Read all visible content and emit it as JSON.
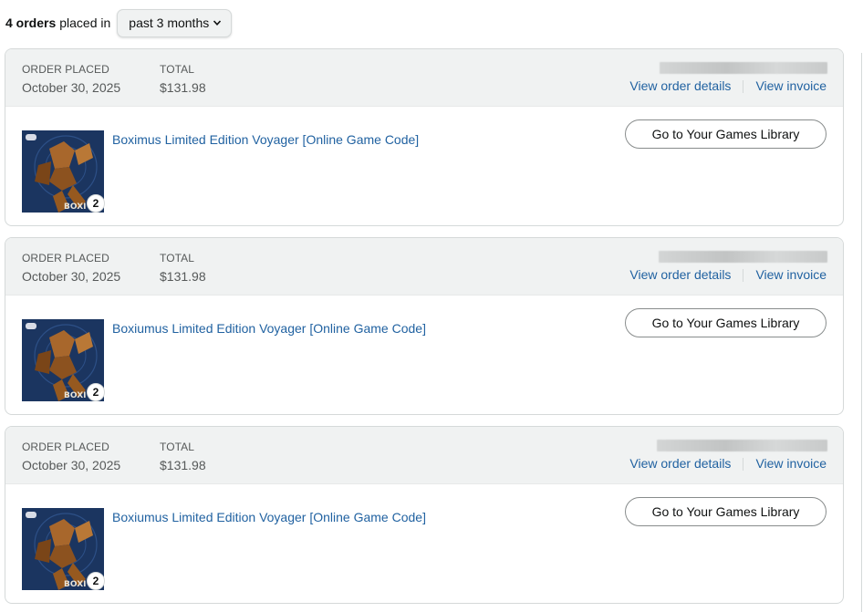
{
  "summary": {
    "count": "4 orders",
    "rest": "placed in",
    "period": "past 3 months"
  },
  "orders": [
    {
      "placed_label": "ORDER PLACED",
      "placed_date": "October 30, 2025",
      "total_label": "TOTAL",
      "total": "$131.98",
      "view_details": "View order details",
      "view_invoice": "View invoice",
      "product": "Boximus Limited Edition Voyager [Online Game Code]",
      "quantity": "2",
      "button": "Go to Your Games Library"
    },
    {
      "placed_label": "ORDER PLACED",
      "placed_date": "October 30, 2025",
      "total_label": "TOTAL",
      "total": "$131.98",
      "view_details": "View order details",
      "view_invoice": "View invoice",
      "product": "Boxiumus Limited Edition Voyager [Online Game Code]",
      "quantity": "2",
      "button": "Go to Your Games Library"
    },
    {
      "placed_label": "ORDER PLACED",
      "placed_date": "October 30, 2025",
      "total_label": "TOTAL",
      "total": "$131.98",
      "view_details": "View order details",
      "view_invoice": "View invoice",
      "product": "Boxiumus Limited Edition Voyager [Online Game Code]",
      "quantity": "2",
      "button": "Go to Your Games Library"
    }
  ],
  "colors": {
    "link": "#2162a1",
    "header_bg": "#f0f2f2",
    "border": "#d5d9d9",
    "thumb_bg": "#1b3560",
    "robot": "#a8672c"
  },
  "icons": {
    "dropdown": "chevron-down-icon",
    "thumbnail": "game-cover-image"
  }
}
